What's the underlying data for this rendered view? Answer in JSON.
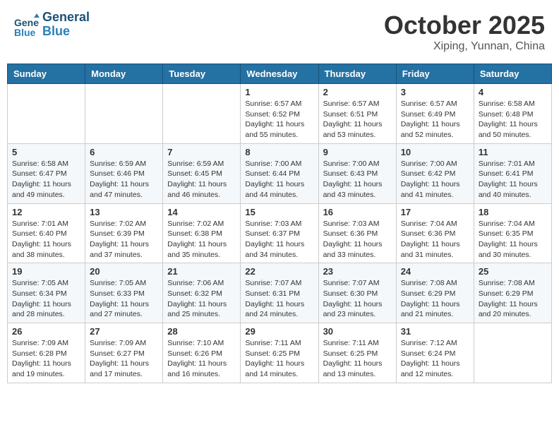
{
  "header": {
    "logo_line1": "General",
    "logo_line2": "Blue",
    "month": "October 2025",
    "location": "Xiping, Yunnan, China"
  },
  "weekdays": [
    "Sunday",
    "Monday",
    "Tuesday",
    "Wednesday",
    "Thursday",
    "Friday",
    "Saturday"
  ],
  "weeks": [
    [
      {
        "day": "",
        "info": ""
      },
      {
        "day": "",
        "info": ""
      },
      {
        "day": "",
        "info": ""
      },
      {
        "day": "1",
        "info": "Sunrise: 6:57 AM\nSunset: 6:52 PM\nDaylight: 11 hours\nand 55 minutes."
      },
      {
        "day": "2",
        "info": "Sunrise: 6:57 AM\nSunset: 6:51 PM\nDaylight: 11 hours\nand 53 minutes."
      },
      {
        "day": "3",
        "info": "Sunrise: 6:57 AM\nSunset: 6:49 PM\nDaylight: 11 hours\nand 52 minutes."
      },
      {
        "day": "4",
        "info": "Sunrise: 6:58 AM\nSunset: 6:48 PM\nDaylight: 11 hours\nand 50 minutes."
      }
    ],
    [
      {
        "day": "5",
        "info": "Sunrise: 6:58 AM\nSunset: 6:47 PM\nDaylight: 11 hours\nand 49 minutes."
      },
      {
        "day": "6",
        "info": "Sunrise: 6:59 AM\nSunset: 6:46 PM\nDaylight: 11 hours\nand 47 minutes."
      },
      {
        "day": "7",
        "info": "Sunrise: 6:59 AM\nSunset: 6:45 PM\nDaylight: 11 hours\nand 46 minutes."
      },
      {
        "day": "8",
        "info": "Sunrise: 7:00 AM\nSunset: 6:44 PM\nDaylight: 11 hours\nand 44 minutes."
      },
      {
        "day": "9",
        "info": "Sunrise: 7:00 AM\nSunset: 6:43 PM\nDaylight: 11 hours\nand 43 minutes."
      },
      {
        "day": "10",
        "info": "Sunrise: 7:00 AM\nSunset: 6:42 PM\nDaylight: 11 hours\nand 41 minutes."
      },
      {
        "day": "11",
        "info": "Sunrise: 7:01 AM\nSunset: 6:41 PM\nDaylight: 11 hours\nand 40 minutes."
      }
    ],
    [
      {
        "day": "12",
        "info": "Sunrise: 7:01 AM\nSunset: 6:40 PM\nDaylight: 11 hours\nand 38 minutes."
      },
      {
        "day": "13",
        "info": "Sunrise: 7:02 AM\nSunset: 6:39 PM\nDaylight: 11 hours\nand 37 minutes."
      },
      {
        "day": "14",
        "info": "Sunrise: 7:02 AM\nSunset: 6:38 PM\nDaylight: 11 hours\nand 35 minutes."
      },
      {
        "day": "15",
        "info": "Sunrise: 7:03 AM\nSunset: 6:37 PM\nDaylight: 11 hours\nand 34 minutes."
      },
      {
        "day": "16",
        "info": "Sunrise: 7:03 AM\nSunset: 6:36 PM\nDaylight: 11 hours\nand 33 minutes."
      },
      {
        "day": "17",
        "info": "Sunrise: 7:04 AM\nSunset: 6:36 PM\nDaylight: 11 hours\nand 31 minutes."
      },
      {
        "day": "18",
        "info": "Sunrise: 7:04 AM\nSunset: 6:35 PM\nDaylight: 11 hours\nand 30 minutes."
      }
    ],
    [
      {
        "day": "19",
        "info": "Sunrise: 7:05 AM\nSunset: 6:34 PM\nDaylight: 11 hours\nand 28 minutes."
      },
      {
        "day": "20",
        "info": "Sunrise: 7:05 AM\nSunset: 6:33 PM\nDaylight: 11 hours\nand 27 minutes."
      },
      {
        "day": "21",
        "info": "Sunrise: 7:06 AM\nSunset: 6:32 PM\nDaylight: 11 hours\nand 25 minutes."
      },
      {
        "day": "22",
        "info": "Sunrise: 7:07 AM\nSunset: 6:31 PM\nDaylight: 11 hours\nand 24 minutes."
      },
      {
        "day": "23",
        "info": "Sunrise: 7:07 AM\nSunset: 6:30 PM\nDaylight: 11 hours\nand 23 minutes."
      },
      {
        "day": "24",
        "info": "Sunrise: 7:08 AM\nSunset: 6:29 PM\nDaylight: 11 hours\nand 21 minutes."
      },
      {
        "day": "25",
        "info": "Sunrise: 7:08 AM\nSunset: 6:29 PM\nDaylight: 11 hours\nand 20 minutes."
      }
    ],
    [
      {
        "day": "26",
        "info": "Sunrise: 7:09 AM\nSunset: 6:28 PM\nDaylight: 11 hours\nand 19 minutes."
      },
      {
        "day": "27",
        "info": "Sunrise: 7:09 AM\nSunset: 6:27 PM\nDaylight: 11 hours\nand 17 minutes."
      },
      {
        "day": "28",
        "info": "Sunrise: 7:10 AM\nSunset: 6:26 PM\nDaylight: 11 hours\nand 16 minutes."
      },
      {
        "day": "29",
        "info": "Sunrise: 7:11 AM\nSunset: 6:25 PM\nDaylight: 11 hours\nand 14 minutes."
      },
      {
        "day": "30",
        "info": "Sunrise: 7:11 AM\nSunset: 6:25 PM\nDaylight: 11 hours\nand 13 minutes."
      },
      {
        "day": "31",
        "info": "Sunrise: 7:12 AM\nSunset: 6:24 PM\nDaylight: 11 hours\nand 12 minutes."
      },
      {
        "day": "",
        "info": ""
      }
    ]
  ]
}
